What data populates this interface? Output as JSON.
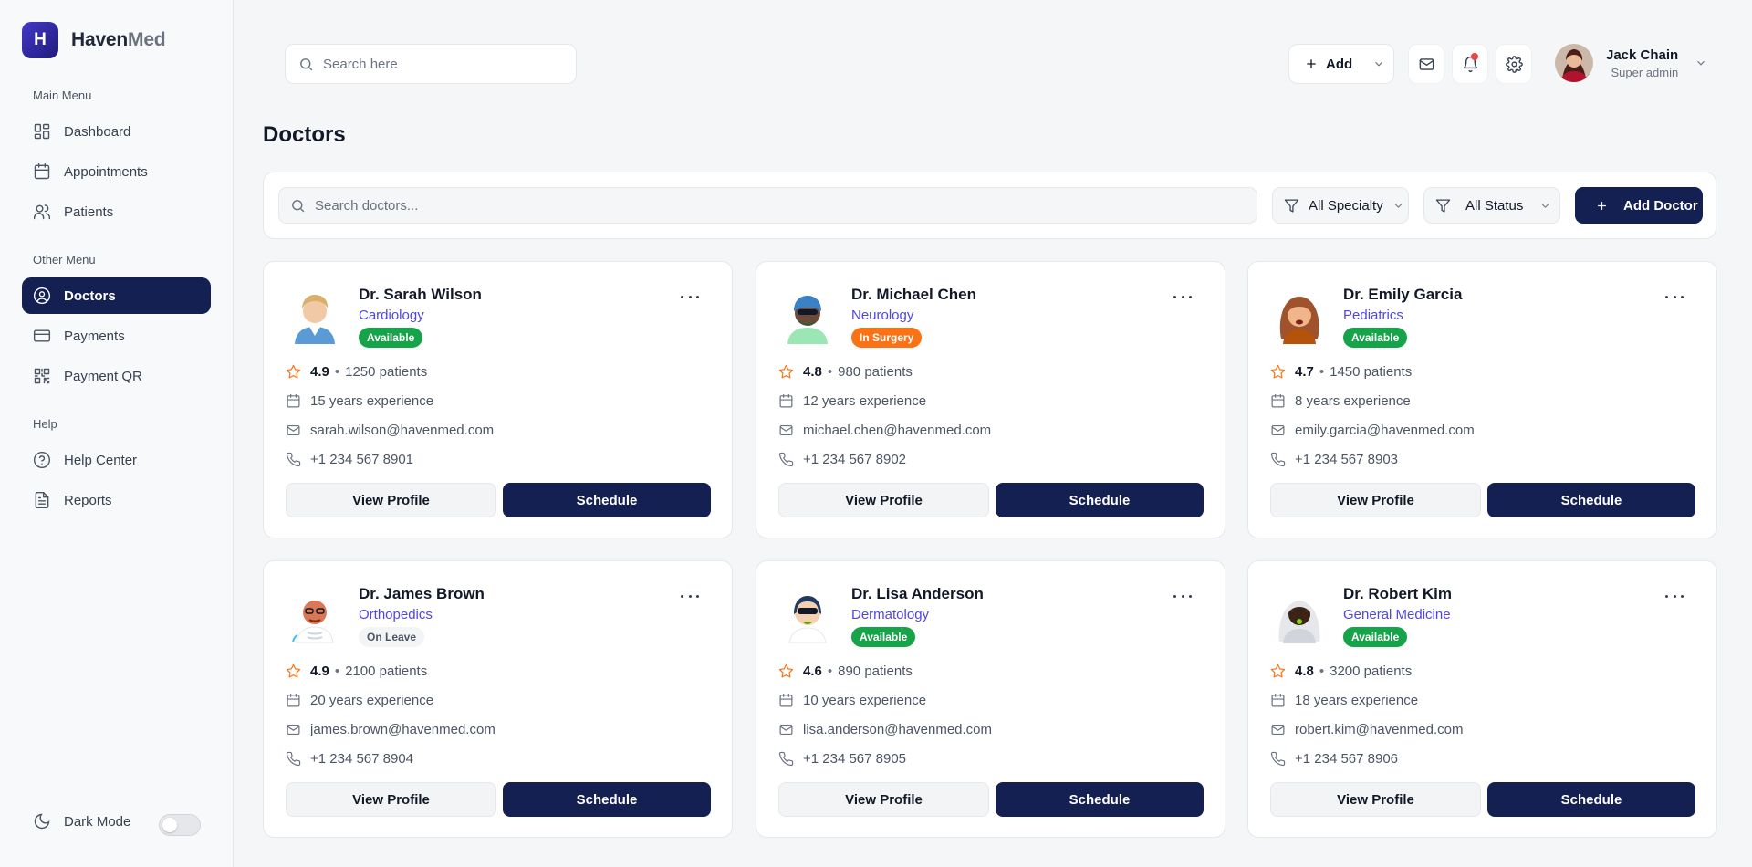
{
  "brand": {
    "logo_letter": "H",
    "name_main": "Haven",
    "name_accent": "Med"
  },
  "sidebar": {
    "main_menu_label": "Main Menu",
    "other_menu_label": "Other Menu",
    "help_label": "Help",
    "items": [
      {
        "label": "Dashboard",
        "icon": "dashboard-icon"
      },
      {
        "label": "Appointments",
        "icon": "calendar-icon"
      },
      {
        "label": "Patients",
        "icon": "users-icon"
      },
      {
        "label": "Doctors",
        "icon": "user-circle-icon",
        "active": true
      },
      {
        "label": "Payments",
        "icon": "credit-card-icon"
      },
      {
        "label": "Payment QR",
        "icon": "qr-code-icon"
      },
      {
        "label": "Help Center",
        "icon": "help-circle-icon"
      },
      {
        "label": "Reports",
        "icon": "file-text-icon"
      }
    ],
    "dark_mode_label": "Dark Mode",
    "dark_mode_on": false
  },
  "header": {
    "search_placeholder": "Search here",
    "add_label": "Add",
    "user": {
      "name": "Jack Chain",
      "role": "Super admin"
    },
    "has_notification": true
  },
  "page": {
    "title": "Doctors",
    "search_placeholder": "Search doctors...",
    "specialty_filter": "All Specialty",
    "status_filter": "All Status",
    "add_doctor_label": "Add Doctor"
  },
  "card_labels": {
    "view_profile": "View Profile",
    "schedule": "Schedule"
  },
  "colors": {
    "primary": "#141f52",
    "accent": "#4f46e5",
    "available": "#16a34a",
    "surgery": "#f97316",
    "star": "#f97316"
  },
  "doctors": [
    {
      "name": "Dr. Sarah Wilson",
      "specialty": "Cardiology",
      "status": "Available",
      "rating": "4.9",
      "patients": "1250 patients",
      "experience": "15 years experience",
      "email": "sarah.wilson@havenmed.com",
      "phone": "+1 234 567 8901"
    },
    {
      "name": "Dr. Michael Chen",
      "specialty": "Neurology",
      "status": "In Surgery",
      "rating": "4.8",
      "patients": "980 patients",
      "experience": "12 years experience",
      "email": "michael.chen@havenmed.com",
      "phone": "+1 234 567 8902"
    },
    {
      "name": "Dr. Emily Garcia",
      "specialty": "Pediatrics",
      "status": "Available",
      "rating": "4.7",
      "patients": "1450 patients",
      "experience": "8 years experience",
      "email": "emily.garcia@havenmed.com",
      "phone": "+1 234 567 8903"
    },
    {
      "name": "Dr. James Brown",
      "specialty": "Orthopedics",
      "status": "On Leave",
      "rating": "4.9",
      "patients": "2100 patients",
      "experience": "20 years experience",
      "email": "james.brown@havenmed.com",
      "phone": "+1 234 567 8904"
    },
    {
      "name": "Dr. Lisa Anderson",
      "specialty": "Dermatology",
      "status": "Available",
      "rating": "4.6",
      "patients": "890 patients",
      "experience": "10 years experience",
      "email": "lisa.anderson@havenmed.com",
      "phone": "+1 234 567 8905"
    },
    {
      "name": "Dr. Robert Kim",
      "specialty": "General Medicine",
      "status": "Available",
      "rating": "4.8",
      "patients": "3200 patients",
      "experience": "18 years experience",
      "email": "robert.kim@havenmed.com",
      "phone": "+1 234 567 8906"
    }
  ]
}
